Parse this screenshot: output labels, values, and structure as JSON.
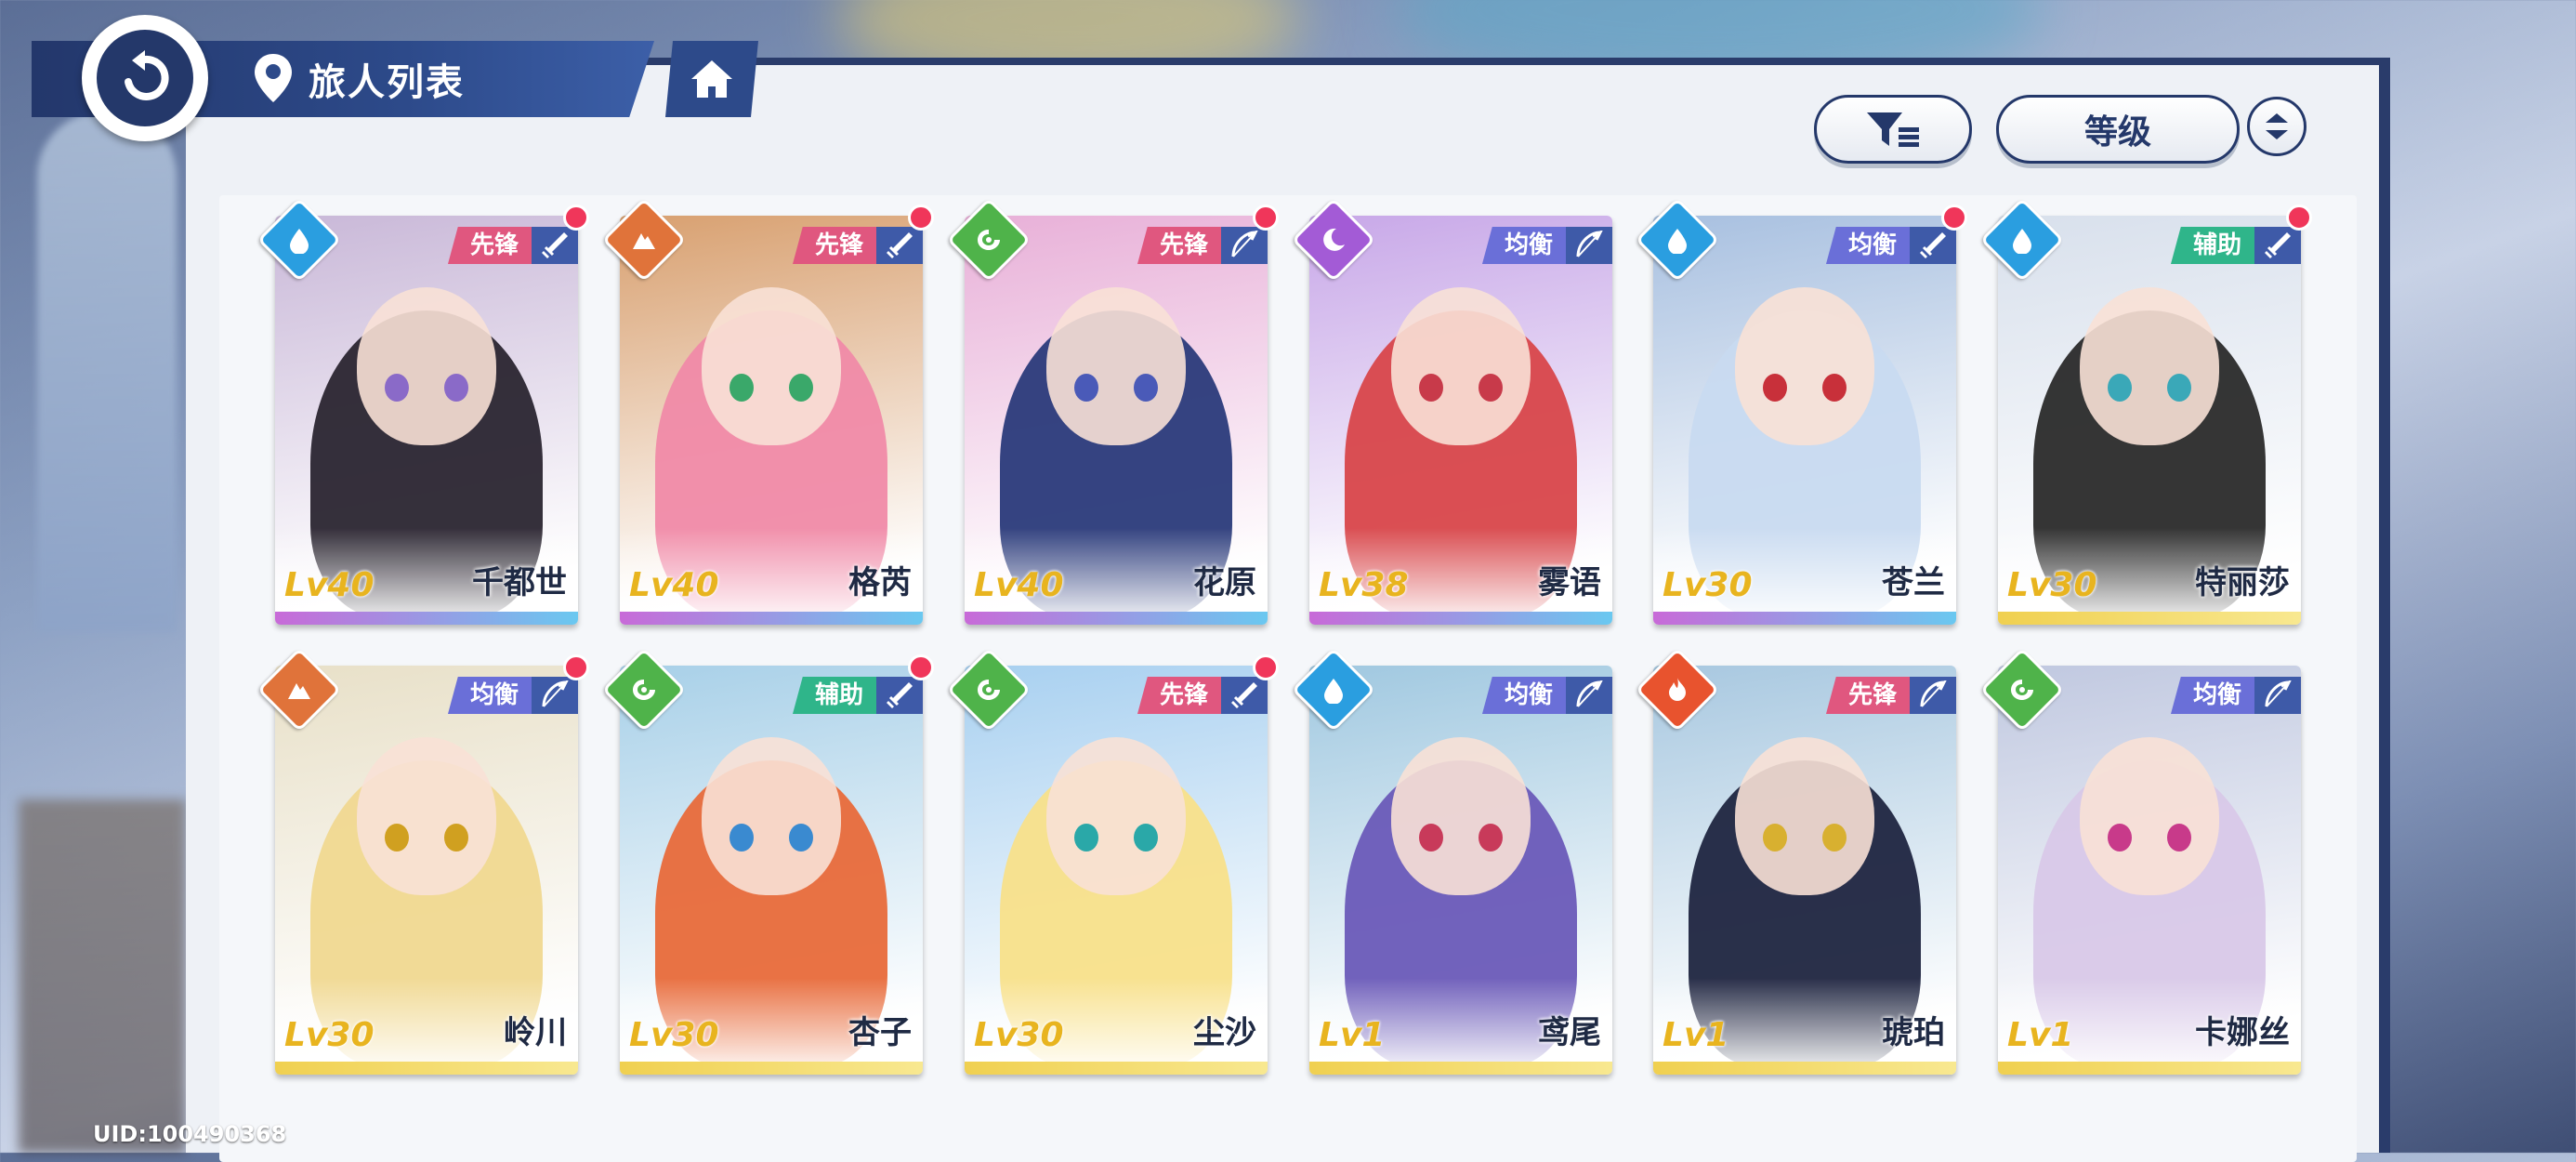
{
  "header": {
    "title": "旅人列表"
  },
  "controls": {
    "sort_label": "等级"
  },
  "uid": "UID:100490368",
  "colors": {
    "navy": "#24386a",
    "role_vanguard": "#e0577f",
    "role_balance": "#6a6fd8",
    "role_support": "#2fb58a",
    "elem_water": "#2a9ee0",
    "elem_earth": "#e0733a",
    "elem_wind": "#4fb34a",
    "elem_moon": "#a35bd6",
    "elem_fire": "#e8532e"
  },
  "cards": [
    {
      "name": "千都世",
      "level": "Lv40",
      "role": "先锋",
      "element": "water-icon",
      "weapon": "sword-icon",
      "new": true,
      "hair": "#2a2530",
      "bg": "#c9b8d8",
      "eye": "#8a6ac8",
      "strip": "linear-gradient(90deg,#c86ad8,#6ac8f0)"
    },
    {
      "name": "格芮",
      "level": "Lv40",
      "role": "先锋",
      "element": "earth-icon",
      "weapon": "sword-icon",
      "new": true,
      "hair": "#f08aa8",
      "bg": "#d8a070",
      "eye": "#3aa86a",
      "strip": "linear-gradient(90deg,#c86ad8,#6ac8f0)"
    },
    {
      "name": "花原",
      "level": "Lv40",
      "role": "先锋",
      "element": "wind-icon",
      "weapon": "bow-icon",
      "new": true,
      "hair": "#2a3a7a",
      "bg": "#e8b0d8",
      "eye": "#4a5ab8",
      "strip": "linear-gradient(90deg,#c86ad8,#6ac8f0)"
    },
    {
      "name": "雾语",
      "level": "Lv38",
      "role": "均衡",
      "element": "moon-icon",
      "weapon": "bow-icon",
      "new": false,
      "hair": "#d8464a",
      "bg": "#c8a8e8",
      "eye": "#c83a4a",
      "strip": "linear-gradient(90deg,#c86ad8,#6ac8f0)"
    },
    {
      "name": "苍兰",
      "level": "Lv30",
      "role": "均衡",
      "element": "water-icon",
      "weapon": "sword-icon",
      "new": true,
      "hair": "#c8daf0",
      "bg": "#a8c0e0",
      "eye": "#c8303a",
      "strip": "linear-gradient(90deg,#c86ad8,#6ac8f0)"
    },
    {
      "name": "特丽莎",
      "level": "Lv30",
      "role": "辅助",
      "element": "water-icon",
      "weapon": "sword-icon",
      "new": true,
      "hair": "#2a2a2a",
      "bg": "#d8e0ec",
      "eye": "#3aa8b8",
      "strip": "linear-gradient(90deg,#f0d050,#f8e890)"
    },
    {
      "name": "岭川",
      "level": "Lv30",
      "role": "均衡",
      "element": "earth-icon",
      "weapon": "bow-icon",
      "new": true,
      "hair": "#f0d890",
      "bg": "#e8e0c8",
      "eye": "#d0a020",
      "strip": "linear-gradient(90deg,#f0d050,#f8e890)"
    },
    {
      "name": "杏子",
      "level": "Lv30",
      "role": "辅助",
      "element": "wind-icon",
      "weapon": "sword-icon",
      "new": true,
      "hair": "#e86a3a",
      "bg": "#a8d0e8",
      "eye": "#3a8ad0",
      "strip": "linear-gradient(90deg,#f0d050,#f8e890)"
    },
    {
      "name": "尘沙",
      "level": "Lv30",
      "role": "先锋",
      "element": "wind-icon",
      "weapon": "sword-icon",
      "new": true,
      "hair": "#f8e08a",
      "bg": "#a8d0f0",
      "eye": "#2aa8a8",
      "strip": "linear-gradient(90deg,#f0d050,#f8e890)"
    },
    {
      "name": "鸢尾",
      "level": "Lv1",
      "role": "均衡",
      "element": "water-icon",
      "weapon": "bow-icon",
      "new": false,
      "hair": "#6a5ab8",
      "bg": "#a0c8e0",
      "eye": "#c83a5a",
      "strip": "linear-gradient(90deg,#f0d050,#f8e890)"
    },
    {
      "name": "琥珀",
      "level": "Lv1",
      "role": "先锋",
      "element": "fire-icon",
      "weapon": "bow-icon",
      "new": false,
      "hair": "#1f2540",
      "bg": "#a8c8e0",
      "eye": "#d8b030",
      "strip": "linear-gradient(90deg,#f0d050,#f8e890)"
    },
    {
      "name": "卡娜丝",
      "level": "Lv1",
      "role": "均衡",
      "element": "wind-icon",
      "weapon": "bow-icon",
      "new": false,
      "hair": "#d8c8e8",
      "bg": "#c0c8e0",
      "eye": "#c83a8a",
      "strip": "linear-gradient(90deg,#f0d050,#f8e890)"
    }
  ]
}
